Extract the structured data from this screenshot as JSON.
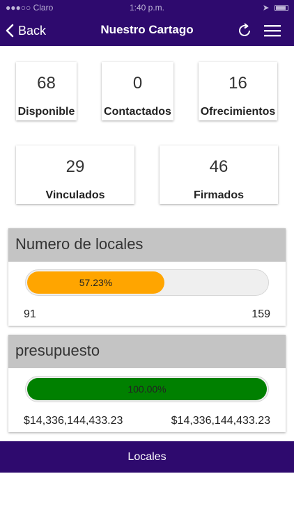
{
  "status": {
    "carrier": "●●●○○ Claro",
    "time": "1:40 p.m."
  },
  "nav": {
    "back_label": "Back",
    "title": "Nuestro Cartago"
  },
  "stats": [
    {
      "value": "68",
      "label": "Disponible"
    },
    {
      "value": "0",
      "label": "Contactados"
    },
    {
      "value": "16",
      "label": "Ofrecimientos"
    },
    {
      "value": "29",
      "label": "Vinculados"
    },
    {
      "value": "46",
      "label": "Firmados"
    }
  ],
  "locales": {
    "title": "Numero de locales",
    "percent_label": "57.23%",
    "percent": 57.23,
    "min": "91",
    "max": "159",
    "color": "#ffa500"
  },
  "presupuesto": {
    "title": "presupuesto",
    "percent_label": "100.00%",
    "percent": 100,
    "min": "$14,336,144,433.23",
    "max": "$14,336,144,433.23",
    "color": "#008000"
  },
  "footer": {
    "label": "Locales"
  },
  "colors": {
    "header": "#2e0a6e",
    "panel_head": "#c4c4c4"
  }
}
